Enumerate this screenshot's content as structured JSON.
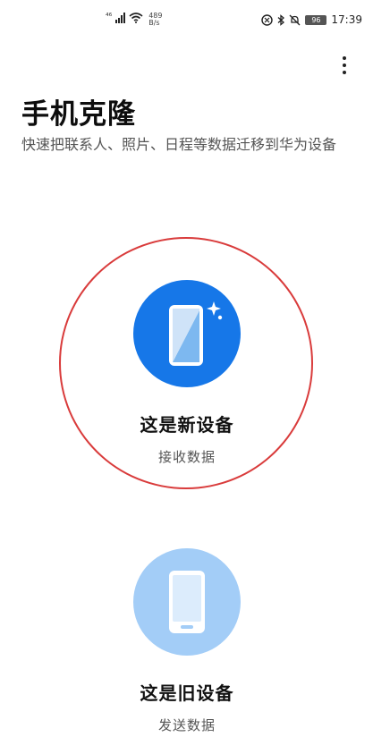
{
  "status_bar": {
    "network_label": "⁴⁶",
    "speed_value": "489",
    "speed_unit": "B/s",
    "battery": "96",
    "time": "17:39"
  },
  "header": {
    "title": "手机克隆",
    "subtitle": "快速把联系人、照片、日程等数据迁移到华为设备"
  },
  "new_device": {
    "title": "这是新设备",
    "subtitle": "接收数据",
    "icon": "phone-sparkle-icon",
    "color": "#1677e8"
  },
  "old_device": {
    "title": "这是旧设备",
    "subtitle": "发送数据",
    "icon": "phone-icon",
    "color": "#a3cdf7"
  },
  "highlight_color": "#d93b3b"
}
